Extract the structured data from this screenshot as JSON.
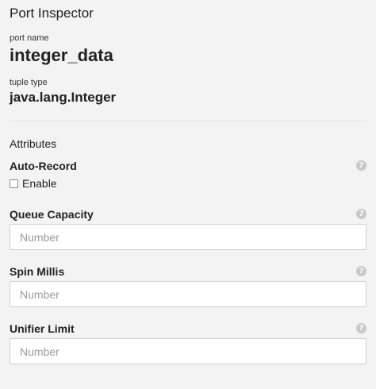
{
  "panel": {
    "title": "Port Inspector",
    "port_name_label": "port name",
    "port_name": "integer_data",
    "tuple_type_label": "tuple type",
    "tuple_type": "java.lang.Integer"
  },
  "attributes": {
    "section_title": "Attributes",
    "auto_record": {
      "label": "Auto-Record",
      "checkbox_label": "Enable",
      "checked": false
    },
    "queue_capacity": {
      "label": "Queue Capacity",
      "placeholder": "Number",
      "value": ""
    },
    "spin_millis": {
      "label": "Spin Millis",
      "placeholder": "Number",
      "value": ""
    },
    "unifier_limit": {
      "label": "Unifier Limit",
      "placeholder": "Number",
      "value": ""
    },
    "help_glyph": "?"
  }
}
